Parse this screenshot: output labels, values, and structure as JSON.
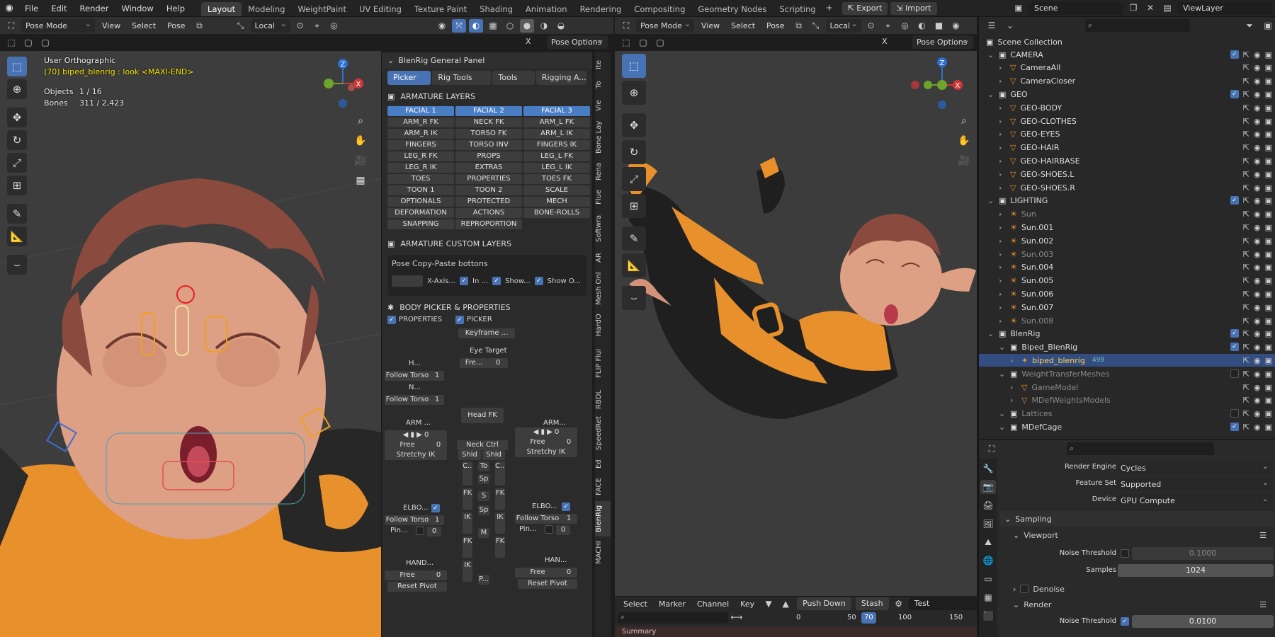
{
  "menubar": {
    "file": "File",
    "edit": "Edit",
    "render": "Render",
    "window": "Window",
    "help": "Help"
  },
  "workspaces": [
    "Layout",
    "Modeling",
    "WeightPaint",
    "UV Editing",
    "Texture Paint",
    "Shading",
    "Animation",
    "Rendering",
    "Compositing",
    "Geometry Nodes",
    "Scripting"
  ],
  "topright": {
    "export": "Export",
    "import": "Import",
    "scene": "Scene",
    "viewlayer": "ViewLayer"
  },
  "vp1": {
    "mode": "Pose Mode",
    "view": "View",
    "select": "Select",
    "pose": "Pose",
    "orientation": "Local",
    "pose_options": "Pose Options",
    "x_label": "X",
    "overlay_line1": "User Orthographic",
    "overlay_line2": "(70) biped_blenrig : look <MAXI-END>",
    "objects_label": "Objects",
    "objects_val": "1 / 16",
    "bones_label": "Bones",
    "bones_val": "311 / 2,423"
  },
  "panel": {
    "title": "BlenRig General Panel",
    "tabs": [
      "Picker",
      "Rig Tools",
      "Tools",
      "Rigging A..."
    ],
    "armature_layers": "ARMATURE LAYERS",
    "layers": [
      "FACIAL 1",
      "FACIAL 2",
      "FACIAL 3",
      "ARM_R FK",
      "NECK FK",
      "ARM_L FK",
      "ARM_R IK",
      "TORSO FK",
      "ARM_L IK",
      "FINGERS",
      "TORSO INV",
      "FINGERS IK",
      "LEG_R FK",
      "PROPS",
      "LEG_L FK",
      "LEG_R IK",
      "EXTRAS",
      "LEG_L IK",
      "TOES",
      "PROPERTIES",
      "TOES FK",
      "TOON 1",
      "TOON 2",
      "SCALE",
      "OPTIONALS",
      "PROTECTED",
      "MECH",
      "DEFORMATION",
      "ACTIONS",
      "BONE-ROLLS",
      "SNAPPING",
      "REPROPORTION"
    ],
    "layers_on": [
      0,
      1,
      2
    ],
    "custom_layers": "ARMATURE CUSTOM LAYERS",
    "copy_paste": "Pose Copy-Paste bottons",
    "xaxis": "X-Axis...",
    "in": "In ...",
    "show1": "Show...",
    "show2": "Show O...",
    "body_picker": "BODY PICKER & PROPERTIES",
    "properties": "PROPERTIES",
    "picker": "PICKER",
    "keyframe": "Keyframe ...",
    "eye_target": "Eye Target",
    "fre": "Fre...",
    "zero": "0",
    "one": "1",
    "h": "H...",
    "n": "N...",
    "follow_torso": "Follow Torso",
    "head_fk": "Head FK",
    "arm_l": "ARM ...",
    "arm_r": "ARM...",
    "free": "Free",
    "stretchy_ik": "Stretchy IK",
    "neck_ctrl": "Neck Ctrl",
    "shld": "Shld",
    "elbo_l": "ELBO...",
    "elbo_r": "ELBO...",
    "pin": "Pin...",
    "hand_l": "HAND...",
    "hand_r": "HAN...",
    "reset_pivot": "Reset Pivot",
    "fk": "FK",
    "ik": "IK",
    "to": "To",
    "sp": "Sp",
    "s": "S",
    "m": "M",
    "p": "P...",
    "c": "C..."
  },
  "vtabs": [
    "Ite",
    "To",
    "Vie",
    "Bone Lay",
    "Rena",
    "Flue",
    "Softwra",
    "AR",
    "Mesh Onl",
    "HardO",
    "FLIP Flui",
    "RBDL",
    "SpeedRet",
    "Ed",
    "FACE",
    "BlenRig",
    "MACHI"
  ],
  "vp2": {
    "mode": "Pose Mode",
    "view": "View",
    "select": "Select",
    "pose": "Pose",
    "orientation": "Local",
    "pose_options": "Pose Options",
    "x_label": "X"
  },
  "timeline": {
    "select": "Select",
    "marker": "Marker",
    "channel": "Channel",
    "key": "Key",
    "push_down": "Push Down",
    "stash": "Stash",
    "action": "Test",
    "summary": "Summary",
    "frames": [
      "0",
      "50",
      "100",
      "150"
    ],
    "current_frame": "70"
  },
  "outliner": {
    "title": "Scene Collection",
    "rows": [
      {
        "name": "CAMERA",
        "indent": 1,
        "type": "coll"
      },
      {
        "name": "CameraAll",
        "indent": 2,
        "type": "obj"
      },
      {
        "name": "CameraCloser",
        "indent": 2,
        "type": "obj"
      },
      {
        "name": "GEO",
        "indent": 1,
        "type": "coll"
      },
      {
        "name": "GEO-BODY",
        "indent": 2,
        "type": "obj"
      },
      {
        "name": "GEO-CLOTHES",
        "indent": 2,
        "type": "obj"
      },
      {
        "name": "GEO-EYES",
        "indent": 2,
        "type": "obj"
      },
      {
        "name": "GEO-HAIR",
        "indent": 2,
        "type": "obj"
      },
      {
        "name": "GEO-HAIRBASE",
        "indent": 2,
        "type": "obj"
      },
      {
        "name": "GEO-SHOES.L",
        "indent": 2,
        "type": "obj"
      },
      {
        "name": "GEO-SHOES.R",
        "indent": 2,
        "type": "obj"
      },
      {
        "name": "LIGHTING",
        "indent": 1,
        "type": "coll"
      },
      {
        "name": "Sun",
        "indent": 2,
        "type": "light",
        "dim": true
      },
      {
        "name": "Sun.001",
        "indent": 2,
        "type": "light"
      },
      {
        "name": "Sun.002",
        "indent": 2,
        "type": "light"
      },
      {
        "name": "Sun.003",
        "indent": 2,
        "type": "light",
        "dim": true
      },
      {
        "name": "Sun.004",
        "indent": 2,
        "type": "light"
      },
      {
        "name": "Sun.005",
        "indent": 2,
        "type": "light"
      },
      {
        "name": "Sun.006",
        "indent": 2,
        "type": "light"
      },
      {
        "name": "Sun.007",
        "indent": 2,
        "type": "light"
      },
      {
        "name": "Sun.008",
        "indent": 2,
        "type": "light",
        "dim": true
      },
      {
        "name": "BlenRig",
        "indent": 1,
        "type": "coll"
      },
      {
        "name": "Biped_BlenRig",
        "indent": 2,
        "type": "coll"
      },
      {
        "name": "biped_blenrig",
        "indent": 3,
        "type": "arm",
        "sel": true
      },
      {
        "name": "WeightTransferMeshes",
        "indent": 2,
        "type": "coll",
        "dim": true
      },
      {
        "name": "GameModel",
        "indent": 3,
        "type": "obj",
        "dim": true
      },
      {
        "name": "MDefWeightsModels",
        "indent": 3,
        "type": "obj",
        "dim": true
      },
      {
        "name": "Lattices",
        "indent": 2,
        "type": "coll",
        "dim": true
      },
      {
        "name": "MDefCage",
        "indent": 2,
        "type": "coll"
      }
    ],
    "badge": "499"
  },
  "properties": {
    "render_engine_label": "Render Engine",
    "render_engine": "Cycles",
    "feature_set_label": "Feature Set",
    "feature_set": "Supported",
    "device_label": "Device",
    "device": "GPU Compute",
    "sampling": "Sampling",
    "viewport": "Viewport",
    "noise_threshold": "Noise Threshold",
    "noise_val_vp": "0.1000",
    "samples": "Samples",
    "samples_val": "1024",
    "denoise": "Denoise",
    "render": "Render",
    "noise_val_r": "0.0100"
  }
}
